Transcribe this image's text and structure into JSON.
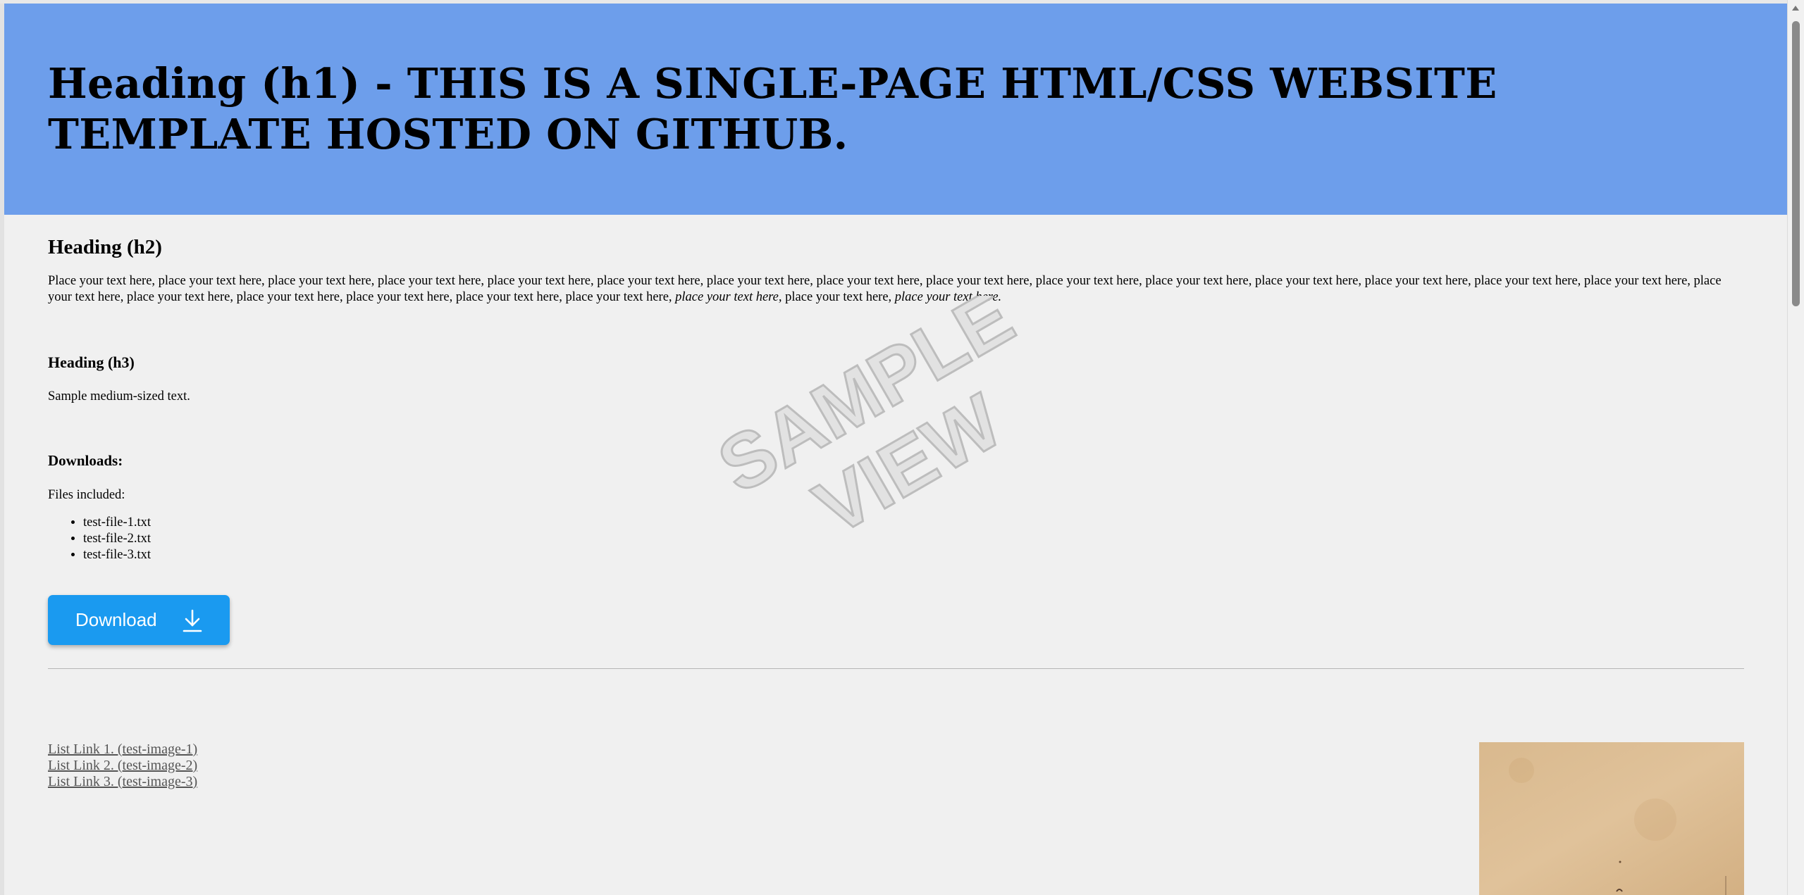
{
  "header": {
    "h1": "Heading (h1) - THIS IS A SINGLE-PAGE HTML/CSS WEBSITE TEMPLATE HOSTED ON GITHUB."
  },
  "section": {
    "h2": "Heading (h2)",
    "paragraph_plain": "Place your text here, place your text here, place your text here, place your text here, place your text here, place your text here, place your text here, place your text here, place your text here, place your text here, place your text here, place your text here, place your text here, place your text here, place your text here, place your text here, place your text here, place your text here, place your text here, place your text here, place your text here,",
    "paragraph_italic_1": "place your text here,",
    "paragraph_mid": "place your text here,",
    "paragraph_italic_2": "place your text here.",
    "h3": "Heading (h3)",
    "medium_text": "Sample medium-sized text."
  },
  "downloads": {
    "heading": "Downloads:",
    "files_label": "Files included:",
    "files": [
      "test-file-1.txt",
      "test-file-2.txt",
      "test-file-3.txt"
    ],
    "button_label": "Download",
    "button_color": "#1a9af0"
  },
  "links": [
    "List Link 1. (test-image-1)",
    "List Link 2. (test-image-2)",
    "List Link 3. (test-image-3)"
  ],
  "watermark": {
    "line1": "SAMPLE",
    "line2": "VIEW"
  },
  "colors": {
    "banner": "#6d9eeb",
    "background": "#f0f0f0"
  }
}
